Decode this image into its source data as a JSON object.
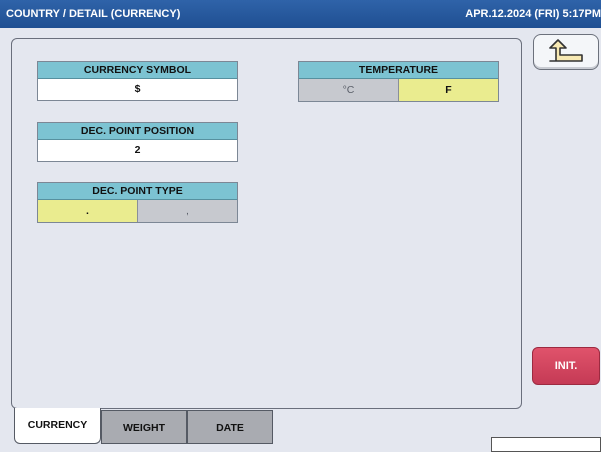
{
  "header": {
    "title": "COUNTRY / DETAIL (CURRENCY)",
    "datetime": "APR.12.2024 (FRI)  5:17PM"
  },
  "currency_symbol": {
    "label": "CURRENCY SYMBOL",
    "value": "$"
  },
  "temperature": {
    "label": "TEMPERATURE",
    "options": [
      "°C",
      "F"
    ],
    "selected": "F"
  },
  "dec_point_position": {
    "label": "DEC. POINT POSITION",
    "value": "2"
  },
  "dec_point_type": {
    "label": "DEC. POINT TYPE",
    "options": [
      ".",
      ","
    ],
    "selected": "."
  },
  "buttons": {
    "init": "INIT."
  },
  "tabs": [
    {
      "label": "CURRENCY",
      "active": true
    },
    {
      "label": "WEIGHT",
      "active": false
    },
    {
      "label": "DATE",
      "active": false
    }
  ],
  "colors": {
    "header_bg": "#2f63a9",
    "label_bg": "#7cc3d2",
    "selected_bg": "#eaec8f",
    "unselected_bg": "#c7c9cf",
    "init_bg": "#d84a63"
  }
}
